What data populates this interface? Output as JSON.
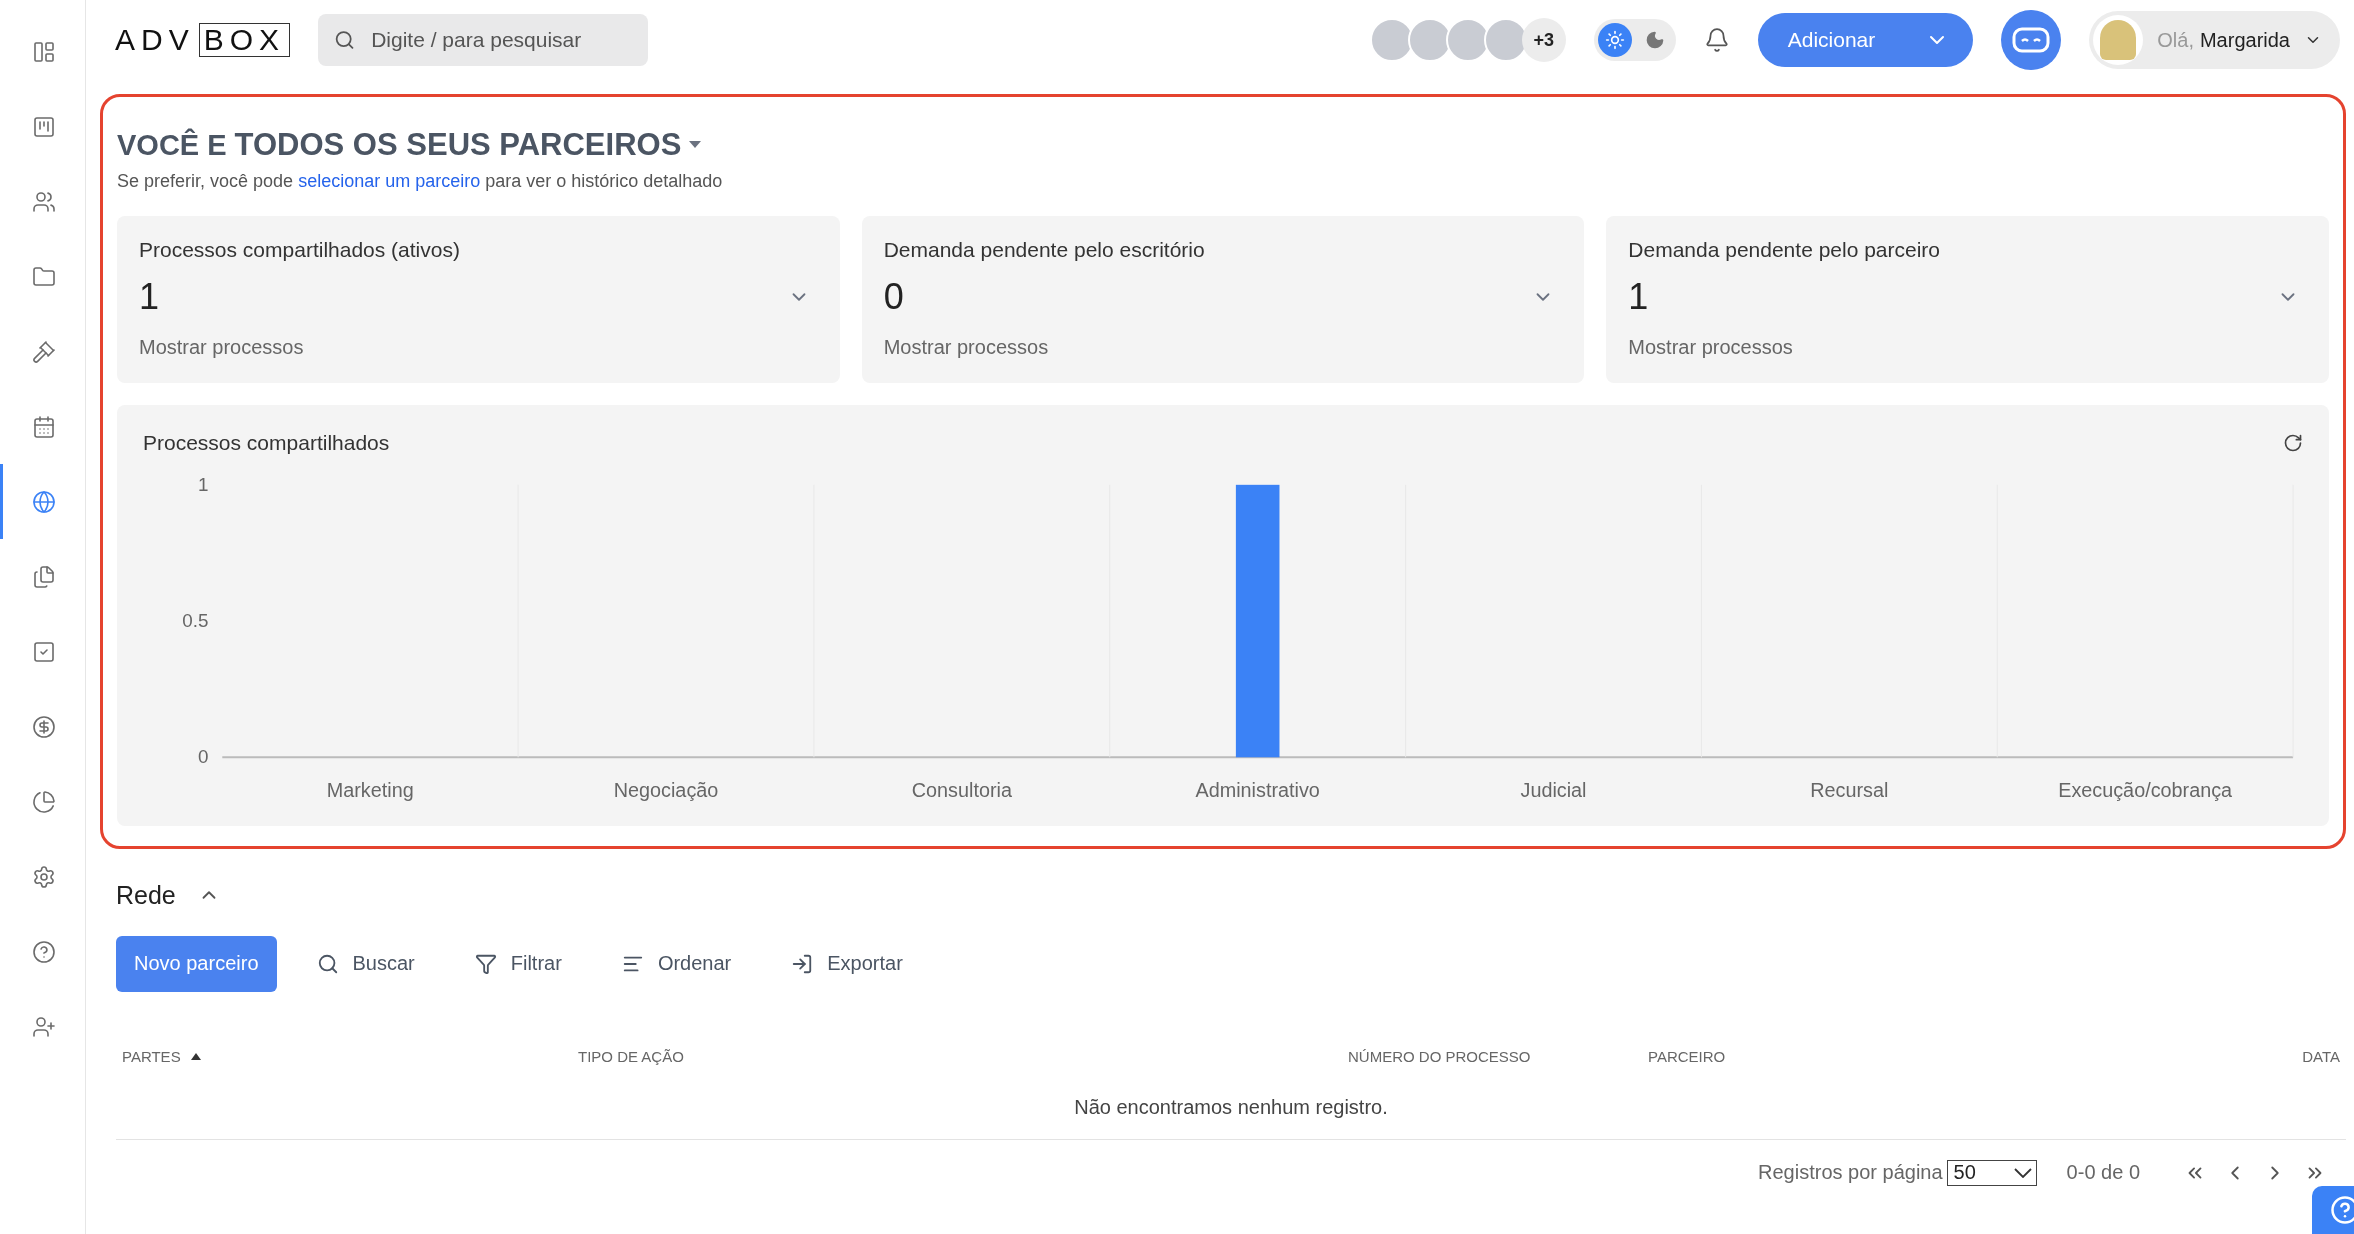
{
  "sidebar": {
    "items": [
      {
        "selected": false
      },
      {
        "selected": false
      },
      {
        "selected": false
      },
      {
        "selected": false
      },
      {
        "selected": false
      },
      {
        "selected": false
      },
      {
        "selected": true
      },
      {
        "selected": false
      },
      {
        "selected": false
      },
      {
        "selected": false
      },
      {
        "selected": false
      },
      {
        "selected": false
      },
      {
        "selected": false
      },
      {
        "selected": false
      }
    ]
  },
  "topbar": {
    "logo": {
      "plain": "ADV",
      "boxed": "BOX"
    },
    "search": {
      "placeholder": "Digite / para pesquisar"
    },
    "team_more": "+3",
    "theme_toggle": [
      {
        "kind": "sun",
        "selected": true
      },
      {
        "kind": "moon",
        "selected": false
      }
    ],
    "add_button": "Adicionar",
    "user": {
      "greeting": "Olá,",
      "name": "Margarida"
    }
  },
  "summary": {
    "title_first": "VOCÊ E",
    "title_rest": "TODOS OS SEUS PARCEIROS",
    "hint_before": "Se preferir, você pode",
    "hint_link": "selecionar um parceiro",
    "hint_after": "para ver o histórico detalhado",
    "cards": [
      {
        "title": "Processos compartilhados (ativos)",
        "value": "1",
        "link": "Mostrar processos",
        "expanded": false
      },
      {
        "title": "Demanda pendente pelo escritório",
        "value": "0",
        "link": "Mostrar processos",
        "expanded": false
      },
      {
        "title": "Demanda pendente pelo parceiro",
        "value": "1",
        "link": "Mostrar processos",
        "expanded": false
      }
    ],
    "chart": {
      "title": "Processos compartilhados",
      "chart_data": {
        "type": "bar",
        "categories": [
          "Marketing",
          "Negociação",
          "Consultoria",
          "Administrativo",
          "Judicial",
          "Recursal",
          "Execução/cobrança"
        ],
        "series": [
          {
            "color": "#3b82f6",
            "values": [
              0,
              0,
              0,
              1,
              0,
              0,
              0
            ]
          }
        ],
        "ylim": [
          0,
          1
        ],
        "yticks": [
          0,
          {
            "value": 0.5,
            "label": "0.5"
          },
          1
        ]
      }
    }
  },
  "network": {
    "title": "Rede",
    "expanded": true,
    "primary_button": "Novo parceiro",
    "actions": [
      {
        "kind": "search",
        "label": "Buscar"
      },
      {
        "kind": "filter",
        "label": "Filtrar"
      },
      {
        "kind": "sort",
        "label": "Ordenar"
      },
      {
        "kind": "export",
        "label": "Exportar"
      }
    ],
    "columns": [
      {
        "label": "PARTES",
        "sorted": true
      },
      {
        "label": "TIPO DE AÇÃO",
        "sorted": false
      },
      {
        "label": "NÚMERO DO PROCESSO",
        "sorted": false
      },
      {
        "label": "PARCEIRO",
        "sorted": false
      },
      {
        "label": "DATA",
        "sorted": false
      }
    ],
    "empty": "Não encontramos nenhum registro.",
    "pagination": {
      "per_page_label": "Registros por página",
      "per_page": "50",
      "range": "0-0 de 0"
    }
  }
}
